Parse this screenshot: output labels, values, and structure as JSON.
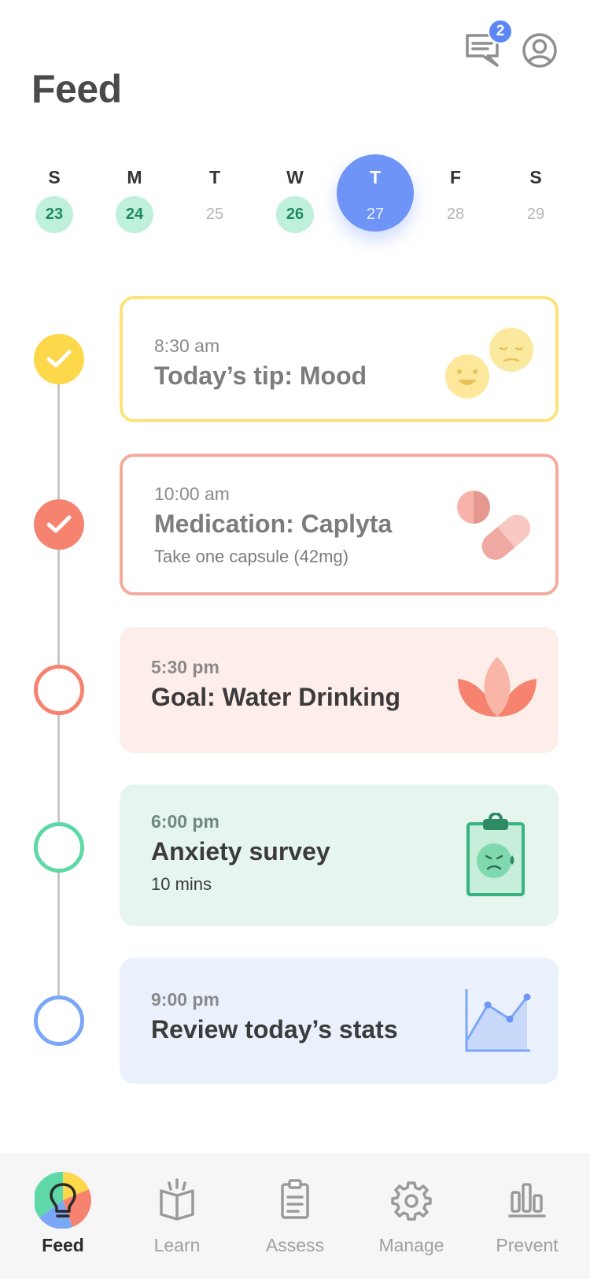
{
  "header": {
    "title": "Feed",
    "messages_badge": "2"
  },
  "week": [
    {
      "letter": "S",
      "date": "23",
      "state": "done"
    },
    {
      "letter": "M",
      "date": "24",
      "state": "done"
    },
    {
      "letter": "T",
      "date": "25",
      "state": "none"
    },
    {
      "letter": "W",
      "date": "26",
      "state": "done"
    },
    {
      "letter": "T",
      "date": "27",
      "state": "selected"
    },
    {
      "letter": "F",
      "date": "28",
      "state": "none"
    },
    {
      "letter": "S",
      "date": "29",
      "state": "none"
    }
  ],
  "feed": [
    {
      "time": "8:30 am",
      "title": "Today’s tip: Mood",
      "subtitle": "",
      "status": "completed",
      "color": "#fcd84a"
    },
    {
      "time": "10:00 am",
      "title": "Medication: Caplyta",
      "subtitle": "Take one capsule (42mg)",
      "status": "completed",
      "color": "#f6836f"
    },
    {
      "time": "5:30 pm",
      "title": "Goal: Water Drinking",
      "subtitle": "",
      "status": "pending",
      "color": "#f6836f"
    },
    {
      "time": "6:00 pm",
      "title": "Anxiety survey",
      "subtitle": "10 mins",
      "status": "pending",
      "color": "#5ed8a7"
    },
    {
      "time": "9:00 pm",
      "title": "Review today’s stats",
      "subtitle": "",
      "status": "pending",
      "color": "#7ba7f7"
    }
  ],
  "nav": [
    {
      "label": "Feed",
      "icon": "lightbulb-icon",
      "active": true
    },
    {
      "label": "Learn",
      "icon": "book-icon",
      "active": false
    },
    {
      "label": "Assess",
      "icon": "clipboard-icon",
      "active": false
    },
    {
      "label": "Manage",
      "icon": "gear-icon",
      "active": false
    },
    {
      "label": "Prevent",
      "icon": "bar-chart-icon",
      "active": false
    }
  ]
}
